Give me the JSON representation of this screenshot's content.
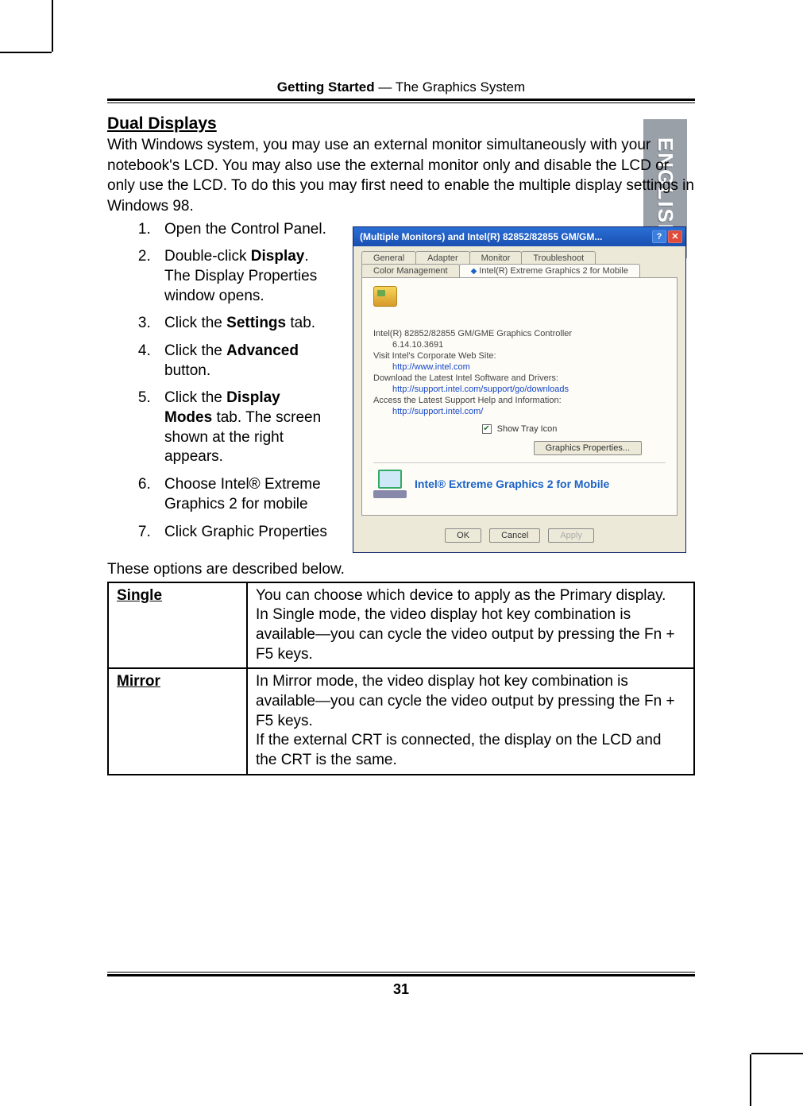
{
  "running_head": {
    "bold": "Getting Started",
    "sep": " — ",
    "rest": "The Graphics System"
  },
  "side_tab": "ENGLISH",
  "section_title": "Dual Displays",
  "intro": "With Windows system, you may use an external monitor simultaneously with your notebook's LCD. You may also use the external monitor only and disable the LCD or only use the LCD. To do this you may first need to enable the multiple display settings in Windows 98.",
  "steps": [
    {
      "n": "1.",
      "html": "Open the Control Panel."
    },
    {
      "n": "2.",
      "html": "Double-click <b>Display</b>. The Display Properties window opens."
    },
    {
      "n": "3.",
      "html": "Click the <b>Settings</b> tab."
    },
    {
      "n": "4.",
      "html": "Click the <b>Advanced</b> button."
    },
    {
      "n": "5.",
      "html": "Click the <b>Display Modes</b> tab. The screen shown at the right appears."
    },
    {
      "n": "6.",
      "html": "Choose Intel® Extreme Graphics 2 for mobile"
    },
    {
      "n": "7.",
      "html": "Click Graphic Properties"
    }
  ],
  "dialog": {
    "title": "(Multiple Monitors) and Intel(R) 82852/82855 GM/GM...",
    "tabs_row1": [
      "General",
      "Adapter",
      "Monitor",
      "Troubleshoot"
    ],
    "tabs_row2_left": "Color Management",
    "tabs_row2_right": "Intel(R) Extreme Graphics 2 for Mobile",
    "controller": "Intel(R) 82852/82855 GM/GME Graphics Controller",
    "version": "6.14.10.3691",
    "visit_label": "Visit Intel's Corporate Web Site:",
    "visit_link": "http://www.intel.com",
    "download_label": "Download the Latest Intel Software and Drivers:",
    "download_link": "http://support.intel.com/support/go/downloads",
    "support_label": "Access the Latest Support Help and Information:",
    "support_link": "http://support.intel.com/",
    "tray_label": "Show Tray Icon",
    "gp_button": "Graphics Properties...",
    "brand": "Intel® Extreme Graphics 2 for Mobile",
    "ok": "OK",
    "cancel": "Cancel",
    "apply": "Apply"
  },
  "table_intro": "These options are described below.",
  "table": [
    {
      "key": "Single",
      "desc": "You can choose which device to apply as the Primary display.\nIn Single mode, the video display hot key combination is available—you can cycle the video output by pressing the Fn + F5 keys."
    },
    {
      "key": "Mirror",
      "desc": "In Mirror mode, the video display hot key combination is available—you can cycle the video output by pressing the Fn + F5 keys.\nIf the external CRT is connected, the display on the LCD and the CRT is the same."
    }
  ],
  "page_number": "31"
}
